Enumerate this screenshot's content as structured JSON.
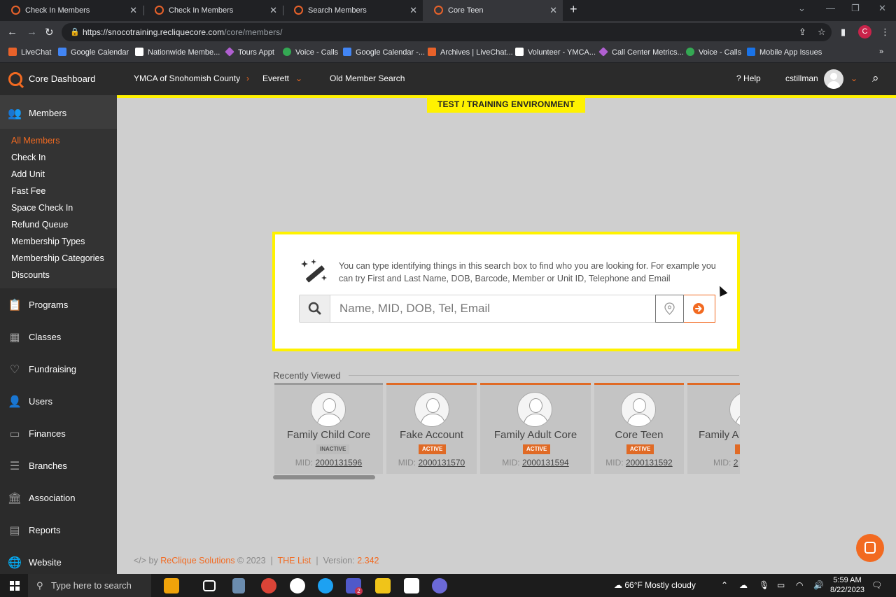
{
  "browser": {
    "tabs": [
      {
        "title": "Check In Members"
      },
      {
        "title": "Check In Members"
      },
      {
        "title": "Search Members"
      },
      {
        "title": "Core Teen"
      }
    ],
    "url_host": "https://snocotraining.recliquecore.com",
    "url_path": "/core/members/",
    "profile_initial": "C",
    "bookmarks": [
      {
        "label": "LiveChat",
        "color": "#e8622a"
      },
      {
        "label": "Google Calendar",
        "color": "#4285f4"
      },
      {
        "label": "Nationwide Membe...",
        "color": "#ffffff"
      },
      {
        "label": "Tours Appt",
        "color": "#b05fd1"
      },
      {
        "label": "Voice - Calls",
        "color": "#34a853"
      },
      {
        "label": "Google Calendar -...",
        "color": "#4285f4"
      },
      {
        "label": "Archives | LiveChat...",
        "color": "#e8622a"
      },
      {
        "label": "Volunteer - YMCA...",
        "color": "#ffffff"
      },
      {
        "label": "Call Center Metrics...",
        "color": "#b05fd1"
      },
      {
        "label": "Voice - Calls",
        "color": "#34a853"
      },
      {
        "label": "Mobile App Issues",
        "color": "#1a73e8"
      }
    ]
  },
  "header": {
    "app_title": "Core Dashboard",
    "org": "YMCA of Snohomish County",
    "branch": "Everett",
    "old_search": "Old Member Search",
    "help": "Help",
    "username": "cstillman",
    "banner": "TEST / TRAINING ENVIRONMENT"
  },
  "sidebar": {
    "active_section": "Members",
    "submenu": [
      {
        "label": "All Members",
        "active": true
      },
      {
        "label": "Check In"
      },
      {
        "label": "Add Unit"
      },
      {
        "label": "Fast Fee"
      },
      {
        "label": "Space Check In"
      },
      {
        "label": "Refund Queue"
      },
      {
        "label": "Membership Types"
      },
      {
        "label": "Membership Categories"
      },
      {
        "label": "Discounts"
      }
    ],
    "sections": [
      {
        "label": "Programs",
        "icon": "clipboard-icon"
      },
      {
        "label": "Classes",
        "icon": "calendar-icon"
      },
      {
        "label": "Fundraising",
        "icon": "donation-icon"
      },
      {
        "label": "Users",
        "icon": "users-icon"
      },
      {
        "label": "Finances",
        "icon": "money-icon"
      },
      {
        "label": "Branches",
        "icon": "branches-icon"
      },
      {
        "label": "Association",
        "icon": "building-icon"
      },
      {
        "label": "Reports",
        "icon": "reports-icon"
      },
      {
        "label": "Website",
        "icon": "globe-icon"
      }
    ]
  },
  "search": {
    "help_text": "You can type identifying things in this search box to find who you are looking for. For example you can try First and Last Name, DOB, Barcode, Member or Unit ID, Telephone and Email",
    "placeholder": "Name, MID, DOB, Tel, Email",
    "value": ""
  },
  "recent": {
    "title": "Recently Viewed",
    "mid_label": "MID:",
    "members": [
      {
        "name": "Family Child Core",
        "status": "INACTIVE",
        "mid": "2000131596"
      },
      {
        "name": "Fake Account",
        "status": "ACTIVE",
        "mid": "2000131570"
      },
      {
        "name": "Family Adult Core",
        "status": "ACTIVE",
        "mid": "2000131594"
      },
      {
        "name": "Core Teen",
        "status": "ACTIVE",
        "mid": "2000131592"
      },
      {
        "name": "Family A",
        "status": "",
        "mid": "2"
      }
    ]
  },
  "footer": {
    "prefix": "</> by",
    "company": "ReClique Solutions",
    "copyright": "© 2023",
    "sep": "|",
    "the_list": "THE List",
    "version_label": "Version:",
    "version": "2.342"
  },
  "taskbar": {
    "search_placeholder": "Type here to search",
    "weather": "66°F  Mostly cloudy",
    "time": "5:59 AM",
    "date": "8/22/2023",
    "teams_badge": "2"
  },
  "colors": {
    "accent": "#f26a21",
    "banner": "#fff200",
    "sidebar": "#2b2b2b"
  }
}
